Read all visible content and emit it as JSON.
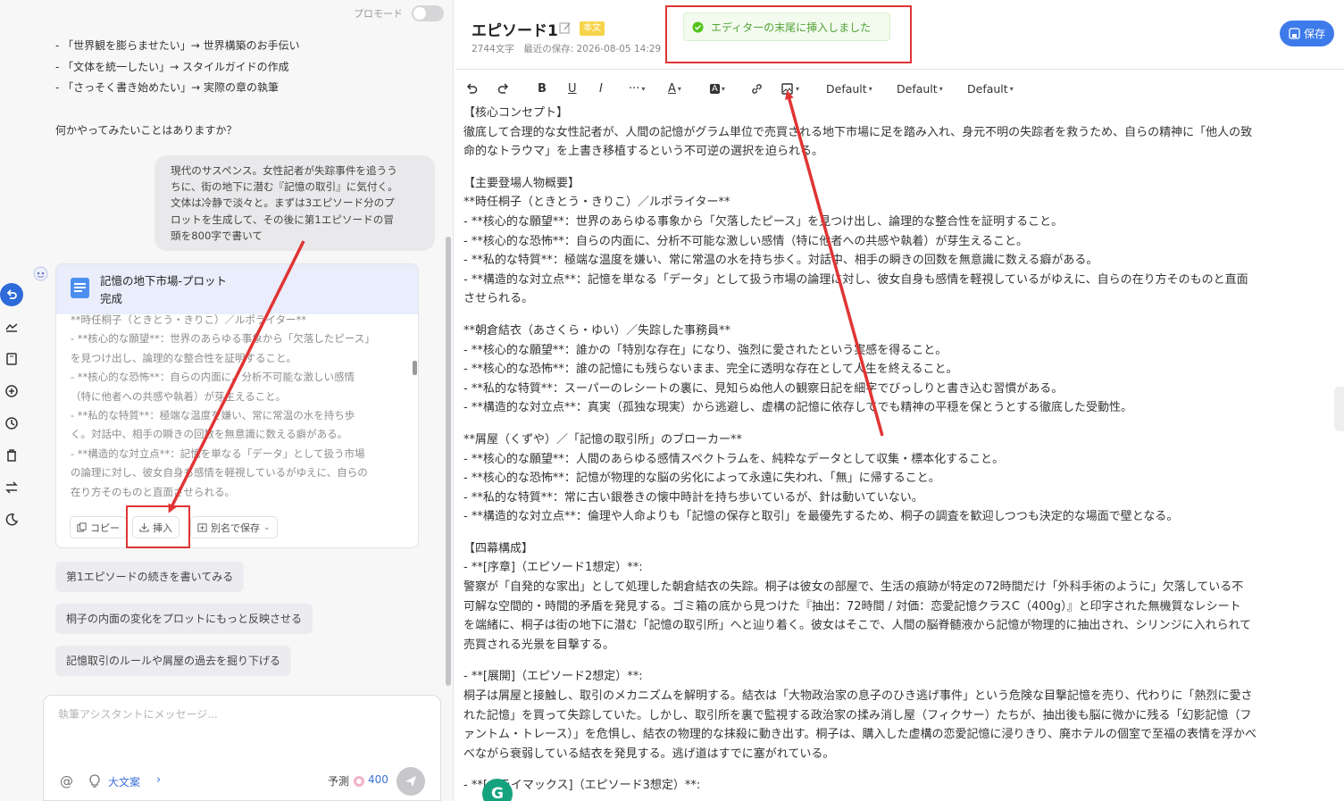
{
  "header": {
    "pro_mode": "プロモード"
  },
  "chat": {
    "lines": [
      "- 「世界観を膨らませたい」→ 世界構築のお手伝い",
      "- 「文体を統一したい」→ スタイルガイドの作成",
      "- 「さっそく書き始めたい」→ 実際の章の執筆"
    ],
    "question": "何かやってみたいことはありますか？",
    "user_message": [
      "現代のサスペンス。女性記者が失踪事件を追うう",
      "ちに、街の地下に潜む『記憶の取引』に気付く。",
      "文体は冷静で淡々と。まずは3エピソード分のプ",
      "ロットを生成して、その後に第1エピソードの冒",
      "頭を800字で書いて"
    ],
    "card": {
      "title": "記憶の地下市場-プロット",
      "status": "完成",
      "lines": [
        "**時任桐子（ときとう・きりこ）／ルポライター**",
        "- **核心的な願望**：世界のあらゆる事象から「欠落したピース」",
        "を見つけ出し、論理的な整合性を証明すること。",
        "- **核心的な恐怖**：自らの内面に、分析不可能な激しい感情",
        "（特に他者への共感や執着）が芽生えること。",
        "- **私的な特質**：極端な温度を嫌い、常に常温の水を持ち歩",
        "く。対話中、相手の瞬きの回数を無意識に数える癖がある。",
        "- **構造的な対立点**：記憶を単なる「データ」として扱う市場",
        "の論理に対し、彼女自身も感情を軽視しているがゆえに、自らの",
        "在り方そのものと直面させられる。"
      ],
      "buttons": {
        "copy": "コピー",
        "insert": "挿入",
        "save_as": "別名で保存"
      }
    },
    "chips": [
      "第1エピソードの続きを書いてみる",
      "桐子の内面の変化をプロットにもっと反映させる",
      "記憶取引のルールや屑屋の過去を掘り下げる"
    ],
    "input": {
      "placeholder": "執筆アシスタントにメッセージ...",
      "mode": "大文案",
      "predict": "予測",
      "credits": "400"
    }
  },
  "editor": {
    "title": "エピソード1",
    "badge": "本文",
    "meta": "2744文字　最近の保存: 2026-08-05 14:29",
    "save_label": "保存",
    "toast": "エディターの末尾に挿入しました",
    "toolbar": {
      "font1": "Default",
      "font2": "Default",
      "font3": "Default",
      "more": "···",
      "text_color": "A",
      "bg_color": "A"
    },
    "content": [
      "【核心コンセプト】",
      "徹底して合理的な女性記者が、人間の記憶がグラム単位で売買される地下市場に足を踏み入れ、身元不明の失踪者を救うため、自らの精神に「他人の致",
      "命的なトラウマ」を上書き移植するという不可逆の選択を迫られる。",
      "",
      "【主要登場人物概要】",
      "**時任桐子（ときとう・きりこ）／ルポライター**",
      "- **核心的な願望**：世界のあらゆる事象から「欠落したピース」を見つけ出し、論理的な整合性を証明すること。",
      "- **核心的な恐怖**：自らの内面に、分析不可能な激しい感情（特に他者への共感や執着）が芽生えること。",
      "- **私的な特質**：極端な温度を嫌い、常に常温の水を持ち歩く。対話中、相手の瞬きの回数を無意識に数える癖がある。",
      "- **構造的な対立点**：記憶を単なる「データ」として扱う市場の論理に対し、彼女自身も感情を軽視しているがゆえに、自らの在り方そのものと直面",
      "させられる。",
      "",
      "**朝倉結衣（あさくら・ゆい）／失踪した事務員**",
      "- **核心的な願望**：誰かの「特別な存在」になり、強烈に愛されたという実感を得ること。",
      "- **核心的な恐怖**：誰の記憶にも残らないまま、完全に透明な存在として人生を終えること。",
      "- **私的な特質**：スーパーのレシートの裏に、見知らぬ他人の観察日記を細字でびっしりと書き込む習慣がある。",
      "- **構造的な対立点**：真実（孤独な現実）から逃避し、虚構の記憶に依存してでも精神の平穏を保とうとする徹底した受動性。",
      "",
      "**屑屋（くずや）／「記憶の取引所」のブローカー**",
      "- **核心的な願望**：人間のあらゆる感情スペクトラムを、純粋なデータとして収集・標本化すること。",
      "- **核心的な恐怖**：記憶が物理的な脳の劣化によって永遠に失われ、「無」に帰すること。",
      "- **私的な特質**：常に古い銀巻きの懐中時計を持ち歩いているが、針は動いていない。",
      "- **構造的な対立点**：倫理や人命よりも「記憶の保存と取引」を最優先するため、桐子の調査を歓迎しつつも決定的な場面で壁となる。",
      "",
      "【四幕構成】",
      "- **[序章]（エピソード1想定）**:",
      "警察が「自発的な家出」として処理した朝倉結衣の失踪。桐子は彼女の部屋で、生活の痕跡が特定の72時間だけ「外科手術のように」欠落している不",
      "可解な空間的・時間的矛盾を発見する。ゴミ箱の底から見つけた『抽出：72時間 / 対価：恋愛記憶クラスC（400g）』と印字された無機質なレシート",
      "を端緒に、桐子は街の地下に潜む「記憶の取引所」へと辿り着く。彼女はそこで、人間の脳脊髄液から記憶が物理的に抽出され、シリンジに入れられて",
      "売買される光景を目撃する。",
      "",
      "- **[展開]（エピソード2想定）**:",
      "桐子は屑屋と接触し、取引のメカニズムを解明する。結衣は「大物政治家の息子のひき逃げ事件」という危険な目撃記憶を売り、代わりに「熱烈に愛さ",
      "れた記憶」を買って失踪していた。しかし、取引所を裏で監視する政治家の揉み消し屋（フィクサー）たちが、抽出後も脳に微かに残る「幻影記憶（フ",
      "ァントム・トレース）」を危惧し、結衣の物理的な抹殺に動き出す。桐子は、購入した虚構の恋愛記憶に浸りきり、廃ホテルの個室で至福の表情を浮かべ",
      "べながら衰弱している結衣を発見する。逃げ道はすでに塞がれている。",
      "",
      "- **[クライマックス]（エピソード3想定）**:"
    ]
  }
}
